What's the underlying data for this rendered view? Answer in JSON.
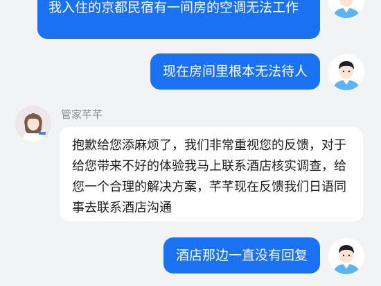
{
  "messages": [
    {
      "side": "user",
      "text": "我入住的京都民宿有一间房的空调无法工作"
    },
    {
      "side": "user",
      "text": "现在房间里根本无法待人"
    },
    {
      "side": "agent",
      "sender": "管家芊芊",
      "text": "抱歉给您添麻烦了，我们非常重视您的反馈，对于给您带来不好的体验我马上联系酒店核实调查，给您一个合理的解决方案，芊芊现在反馈我们日语同事去联系酒店沟通"
    },
    {
      "side": "user",
      "text": "酒店那边一直没有回复"
    }
  ],
  "colors": {
    "user_bubble": "#1a72f2",
    "agent_bubble": "#ffffff",
    "background": "#f2f3f5"
  },
  "icons": {
    "user_avatar": "user-avatar-icon",
    "agent_avatar": "agent-avatar-icon"
  }
}
